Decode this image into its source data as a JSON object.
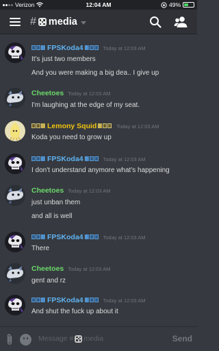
{
  "status_bar": {
    "carrier": "Verizon",
    "time": "12:04 AM",
    "battery": "49%",
    "battery_level": 0.49
  },
  "header": {
    "channel_prefix": "#",
    "channel_name": "media"
  },
  "messages": [
    {
      "author": "FPSKoda4",
      "author_color": "#5fb3f2",
      "time": "Today at 12:03 AM",
      "lines": [
        "It's just two members",
        "And you were making a big dea.. I give up"
      ]
    },
    {
      "author": "Cheetoes",
      "author_color": "#6bd96b",
      "time": "Today at 12:03 AM",
      "lines": [
        "I'm laughing at the edge of my seat."
      ]
    },
    {
      "author": "Lemony Squid",
      "author_color": "#f1c40f",
      "time": "Today at 12:03 AM",
      "lines": [
        "Koda you need to grow up"
      ]
    },
    {
      "author": "FPSKoda4",
      "author_color": "#5fb3f2",
      "time": "Today at 12:03 AM",
      "lines": [
        "I don't understand anymore what's happening"
      ]
    },
    {
      "author": "Cheetoes",
      "author_color": "#6bd96b",
      "time": "Today at 12:03 AM",
      "lines": [
        "just unban them",
        "and all is well"
      ]
    },
    {
      "author": "FPSKoda4",
      "author_color": "#5fb3f2",
      "time": "Today at 12:03 AM",
      "lines": [
        "There"
      ]
    },
    {
      "author": "Cheetoes",
      "author_color": "#6bd96b",
      "time": "Today at 12:03 AM",
      "lines": [
        "gent and rz"
      ]
    },
    {
      "author": "FPSKoda4",
      "author_color": "#5fb3f2",
      "time": "Today at 12:03 AM",
      "lines": [
        "And shut the fuck up about it"
      ]
    }
  ],
  "input": {
    "placeholder_prefix": "Message #",
    "placeholder_channel": "media",
    "send_label": "Send"
  },
  "icons": {
    "menu": "hamburger-menu-icon",
    "search": "search-icon",
    "members": "members-icon",
    "attach": "paperclip-icon",
    "emoji": "emoji-icon",
    "channel_emoji": "game-die-icon"
  }
}
